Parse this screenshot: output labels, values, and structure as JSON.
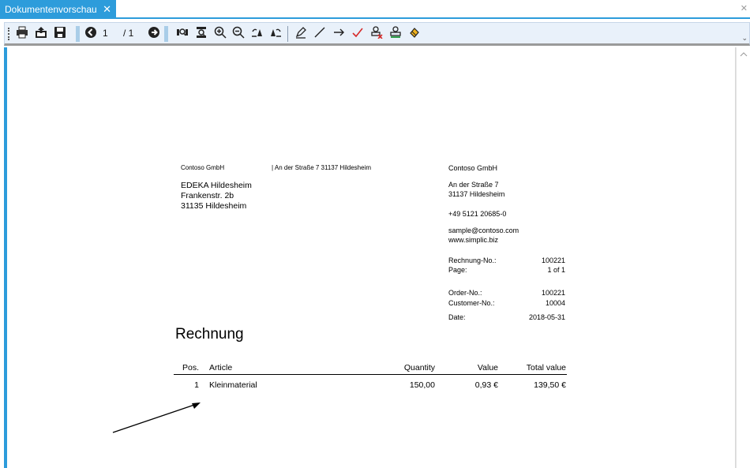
{
  "tab": {
    "title": "Dokumentenvorschau",
    "close": "✕"
  },
  "strip_close": "✕",
  "toolbar": {
    "page_current": "1",
    "page_total": "/ 1",
    "icons": [
      "print-icon",
      "export-icon",
      "save-icon",
      "back-icon",
      "forward-icon",
      "fit-page-icon",
      "fit-width-icon",
      "zoom-in-icon",
      "zoom-out-icon",
      "rotate-left-icon",
      "rotate-right-icon",
      "highlighter-icon",
      "line-icon",
      "arrow-tool-icon",
      "check-icon",
      "stamp-remove-icon",
      "stamp-icon",
      "fill-icon"
    ],
    "overflow": "⌄"
  },
  "document": {
    "sender_line": "Contoso GmbH",
    "sender_address": "| An der Straße 7 31137 Hildesheim",
    "recipient": [
      "EDEKA Hildesheim",
      "Frankenstr. 2b",
      "31135 Hildesheim"
    ],
    "company": {
      "name": "Contoso GmbH",
      "street": "An der Straße 7",
      "city": "31137 Hildesheim",
      "phone": "+49 5121 20685-0",
      "email": "sample@contoso.com",
      "web": "www.simplic.biz"
    },
    "info": [
      {
        "label": "Rechnung-No.:",
        "value": "100221"
      },
      {
        "label": "Page:",
        "value": "1 of 1"
      },
      {
        "label": "Order-No.:",
        "value": "100221"
      },
      {
        "label": "Customer-No.:",
        "value": "10004"
      },
      {
        "label": "Date:",
        "value": "2018-05-31"
      }
    ],
    "title": "Rechnung",
    "table": {
      "headers": [
        "Pos.",
        "Article",
        "Quantity",
        "Value",
        "Total value"
      ],
      "rows": [
        [
          "1",
          "Kleinmaterial",
          "150,00",
          "0,93 €",
          "139,50 €"
        ]
      ]
    }
  }
}
